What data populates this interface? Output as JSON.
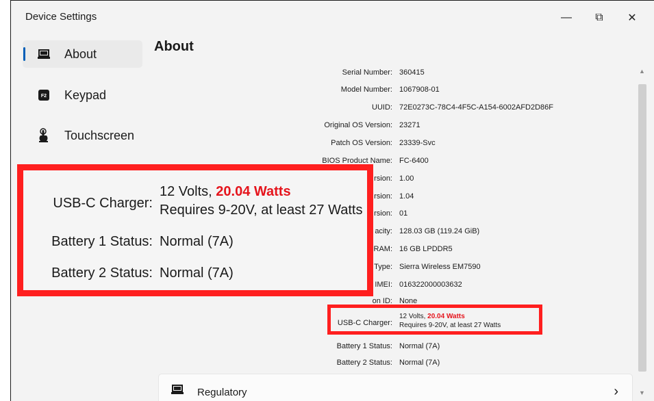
{
  "window": {
    "title": "Device Settings",
    "controls": {
      "minimize": "—",
      "maximize": "⧉",
      "close": "✕"
    }
  },
  "sidebar": {
    "items": [
      {
        "label": "About",
        "icon": "laptop-icon",
        "active": true
      },
      {
        "label": "Keypad",
        "icon": "f2-key-icon",
        "active": false
      },
      {
        "label": "Touchscreen",
        "icon": "touch-hand-icon",
        "active": false
      }
    ]
  },
  "page": {
    "title": "About"
  },
  "info": {
    "serial_label": "Serial Number:",
    "serial_value": "360415",
    "model_label": "Model Number:",
    "model_value": "1067908-01",
    "uuid_label": "UUID:",
    "uuid_value": "72E0273C-78C4-4F5C-A154-6002AFD2D86F",
    "orig_os_label": "Original OS Version:",
    "orig_os_value": "23271",
    "patch_os_label": "Patch OS Version:",
    "patch_os_value": "23339-Svc",
    "bios_label": "BIOS Product Name:",
    "bios_value": "FC-6400",
    "partial1_label": "rsion:",
    "partial1_value": "1.00",
    "partial2_label": "rsion:",
    "partial2_value": "1.04",
    "partial3_label": "rsion:",
    "partial3_value": "01",
    "capacity_label": "acity:",
    "capacity_value": "128.03 GB (119.24 GiB)",
    "ram_label": "RAM:",
    "ram_value": "16 GB LPDDR5",
    "modem_label": "Type:",
    "modem_value": "Sierra Wireless EM7590",
    "imei_label": "IMEI:",
    "imei_value": "016322000003632",
    "expansion_label": "on ID:",
    "expansion_value": "None",
    "charger_label": "USB-C Charger:",
    "charger_volts": "12 Volts, ",
    "charger_watts": "20.04 Watts",
    "charger_requirement": "Requires 9-20V, at least 27 Watts",
    "battery1_label": "Battery 1 Status:",
    "battery1_value": "Normal (7A)",
    "battery2_label": "Battery 2 Status:",
    "battery2_value": "Normal (7A)"
  },
  "regulatory": {
    "label": "Regulatory"
  },
  "colors": {
    "accent": "#005fb8",
    "highlight": "#ff1f1f",
    "warning_text": "#e5141c"
  }
}
